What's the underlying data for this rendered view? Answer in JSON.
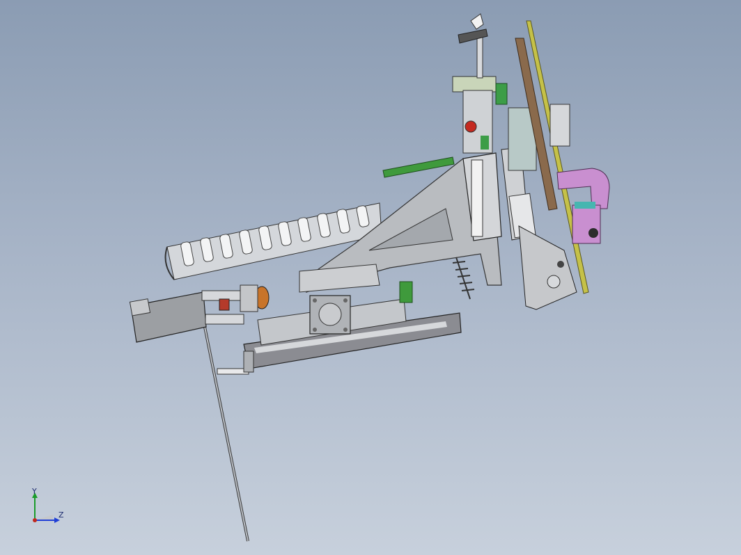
{
  "viewport": {
    "background_top": "#8b9cb3",
    "background_bottom": "#c7d0dc"
  },
  "triad": {
    "y_label": "Y",
    "z_label": "Z",
    "y_color": "#1a9c2a",
    "z_color": "#1f3fd6",
    "x_color": "#c0281f"
  },
  "model": {
    "parts": [
      "servo-motor",
      "coupling",
      "ball-screw",
      "linear-slide-base",
      "drag-chain",
      "triangular-bracket",
      "vertical-linear-guide",
      "cylinder",
      "gripper-block",
      "pcb-strip",
      "long-rod",
      "purple-clamp",
      "wing-knob",
      "brown-plate",
      "yellow-rail"
    ]
  }
}
